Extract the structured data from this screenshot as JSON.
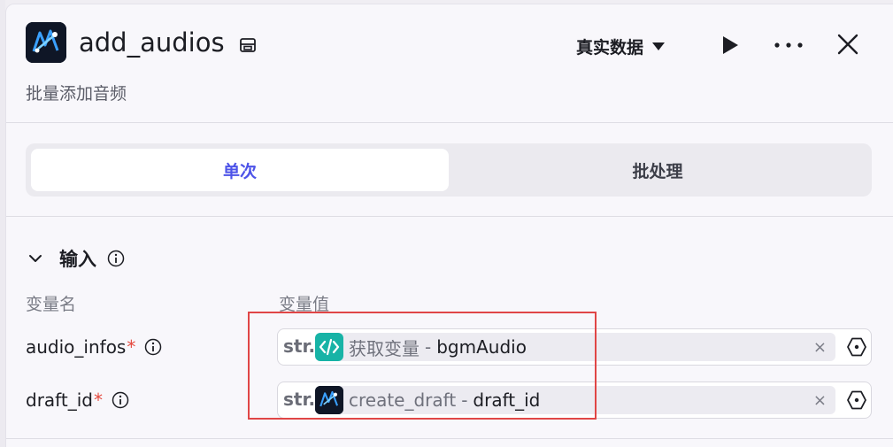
{
  "header": {
    "title": "add_audios",
    "subtitle": "批量添加音频",
    "mode_label": "真实数据"
  },
  "tabs": [
    {
      "label": "单次",
      "active": true
    },
    {
      "label": "批处理",
      "active": false
    }
  ],
  "input_section": {
    "title": "输入",
    "col_name_label": "变量名",
    "col_value_label": "变量值",
    "rows": [
      {
        "name": "audio_infos",
        "required_mark": "*",
        "type": "str.",
        "source_node": "获取变量",
        "separator": "-",
        "variable": "bgmAudio",
        "clear": "×",
        "source_icon": "code-icon"
      },
      {
        "name": "draft_id",
        "required_mark": "*",
        "type": "str.",
        "source_node": "create_draft",
        "separator": "-",
        "variable": "draft_id",
        "clear": "×",
        "source_icon": "plugin-logo-icon"
      }
    ]
  },
  "colors": {
    "accent": "#4d53e8",
    "required": "#e5483d",
    "highlight": "#e04646",
    "code_icon_bg": "#17b3a6"
  }
}
